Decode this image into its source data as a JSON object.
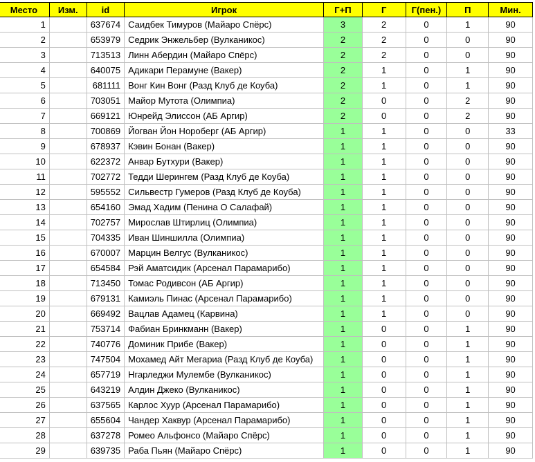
{
  "headers": [
    "Место",
    "Изм.",
    "id",
    "Игрок",
    "Г+П",
    "Г",
    "Г(пен.)",
    "П",
    "Мин."
  ],
  "rows": [
    {
      "place": "1",
      "change": "",
      "id": "637674",
      "player": "Саидбек Тимуров (Майаро Спёрс)",
      "gp": "3",
      "g": "2",
      "gpen": "0",
      "p": "1",
      "min": "90"
    },
    {
      "place": "2",
      "change": "",
      "id": "653979",
      "player": "Седрик Энжельбер (Вулканикос)",
      "gp": "2",
      "g": "2",
      "gpen": "0",
      "p": "0",
      "min": "90"
    },
    {
      "place": "3",
      "change": "",
      "id": "713513",
      "player": "Линн Абердин (Майаро Спёрс)",
      "gp": "2",
      "g": "2",
      "gpen": "0",
      "p": "0",
      "min": "90"
    },
    {
      "place": "4",
      "change": "",
      "id": "640075",
      "player": "Адикари Перамуне (Вакер)",
      "gp": "2",
      "g": "1",
      "gpen": "0",
      "p": "1",
      "min": "90"
    },
    {
      "place": "5",
      "change": "",
      "id": "681111",
      "player": "Вонг Кин Вонг (Разд Клуб де Коуба)",
      "gp": "2",
      "g": "1",
      "gpen": "0",
      "p": "1",
      "min": "90"
    },
    {
      "place": "6",
      "change": "",
      "id": "703051",
      "player": "Майор Мутота (Олимпиа)",
      "gp": "2",
      "g": "0",
      "gpen": "0",
      "p": "2",
      "min": "90"
    },
    {
      "place": "7",
      "change": "",
      "id": "669121",
      "player": "Юнрейд Элиссон (АБ Аргир)",
      "gp": "2",
      "g": "0",
      "gpen": "0",
      "p": "2",
      "min": "90"
    },
    {
      "place": "8",
      "change": "",
      "id": "700869",
      "player": "Йогван Йон Нороберг (АБ Аргир)",
      "gp": "1",
      "g": "1",
      "gpen": "0",
      "p": "0",
      "min": "33"
    },
    {
      "place": "9",
      "change": "",
      "id": "678937",
      "player": "Кэвин Бонан (Вакер)",
      "gp": "1",
      "g": "1",
      "gpen": "0",
      "p": "0",
      "min": "90"
    },
    {
      "place": "10",
      "change": "",
      "id": "622372",
      "player": "Анвар Бутхури (Вакер)",
      "gp": "1",
      "g": "1",
      "gpen": "0",
      "p": "0",
      "min": "90"
    },
    {
      "place": "11",
      "change": "",
      "id": "702772",
      "player": "Тедди Шерингем (Разд Клуб де Коуба)",
      "gp": "1",
      "g": "1",
      "gpen": "0",
      "p": "0",
      "min": "90"
    },
    {
      "place": "12",
      "change": "",
      "id": "595552",
      "player": "Сильвестр Гумеров (Разд Клуб де Коуба)",
      "gp": "1",
      "g": "1",
      "gpen": "0",
      "p": "0",
      "min": "90"
    },
    {
      "place": "13",
      "change": "",
      "id": "654160",
      "player": "Эмад Хадим (Пенина О Салафай)",
      "gp": "1",
      "g": "1",
      "gpen": "0",
      "p": "0",
      "min": "90"
    },
    {
      "place": "14",
      "change": "",
      "id": "702757",
      "player": "Мирослав Штирлиц (Олимпиа)",
      "gp": "1",
      "g": "1",
      "gpen": "0",
      "p": "0",
      "min": "90"
    },
    {
      "place": "15",
      "change": "",
      "id": "704335",
      "player": "Иван Шиншилла (Олимпиа)",
      "gp": "1",
      "g": "1",
      "gpen": "0",
      "p": "0",
      "min": "90"
    },
    {
      "place": "16",
      "change": "",
      "id": "670007",
      "player": "Марцин Велгус (Вулканикос)",
      "gp": "1",
      "g": "1",
      "gpen": "0",
      "p": "0",
      "min": "90"
    },
    {
      "place": "17",
      "change": "",
      "id": "654584",
      "player": "Рэй Аматсидик (Арсенал Парамарибо)",
      "gp": "1",
      "g": "1",
      "gpen": "0",
      "p": "0",
      "min": "90"
    },
    {
      "place": "18",
      "change": "",
      "id": "713450",
      "player": "Томас Родивсон (АБ Аргир)",
      "gp": "1",
      "g": "1",
      "gpen": "0",
      "p": "0",
      "min": "90"
    },
    {
      "place": "19",
      "change": "",
      "id": "679131",
      "player": "Камиэль Пинас (Арсенал Парамарибо)",
      "gp": "1",
      "g": "1",
      "gpen": "0",
      "p": "0",
      "min": "90"
    },
    {
      "place": "20",
      "change": "",
      "id": "669492",
      "player": "Вацлав Адамец (Карвина)",
      "gp": "1",
      "g": "1",
      "gpen": "0",
      "p": "0",
      "min": "90"
    },
    {
      "place": "21",
      "change": "",
      "id": "753714",
      "player": "Фабиан Бринкманн (Вакер)",
      "gp": "1",
      "g": "0",
      "gpen": "0",
      "p": "1",
      "min": "90"
    },
    {
      "place": "22",
      "change": "",
      "id": "740776",
      "player": "Доминик Прибе (Вакер)",
      "gp": "1",
      "g": "0",
      "gpen": "0",
      "p": "1",
      "min": "90"
    },
    {
      "place": "23",
      "change": "",
      "id": "747504",
      "player": "Мохамед Айт Мегариа (Разд Клуб де Коуба)",
      "gp": "1",
      "g": "0",
      "gpen": "0",
      "p": "1",
      "min": "90"
    },
    {
      "place": "24",
      "change": "",
      "id": "657719",
      "player": "Нгарледжи Мулембе (Вулканикос)",
      "gp": "1",
      "g": "0",
      "gpen": "0",
      "p": "1",
      "min": "90"
    },
    {
      "place": "25",
      "change": "",
      "id": "643219",
      "player": "Алдин Джеко (Вулканикос)",
      "gp": "1",
      "g": "0",
      "gpen": "0",
      "p": "1",
      "min": "90"
    },
    {
      "place": "26",
      "change": "",
      "id": "637565",
      "player": "Карлос Хуур (Арсенал Парамарибо)",
      "gp": "1",
      "g": "0",
      "gpen": "0",
      "p": "1",
      "min": "90"
    },
    {
      "place": "27",
      "change": "",
      "id": "655604",
      "player": "Чандер Хаквур (Арсенал Парамарибо)",
      "gp": "1",
      "g": "0",
      "gpen": "0",
      "p": "1",
      "min": "90"
    },
    {
      "place": "28",
      "change": "",
      "id": "637278",
      "player": "Ромео Альфонсо (Майаро Спёрс)",
      "gp": "1",
      "g": "0",
      "gpen": "0",
      "p": "1",
      "min": "90"
    },
    {
      "place": "29",
      "change": "",
      "id": "639735",
      "player": "Раба Пьян (Майаро Спёрс)",
      "gp": "1",
      "g": "0",
      "gpen": "0",
      "p": "1",
      "min": "90"
    }
  ],
  "colors": {
    "header_bg": "#ffff00",
    "highlight_bg": "#99ff99"
  }
}
